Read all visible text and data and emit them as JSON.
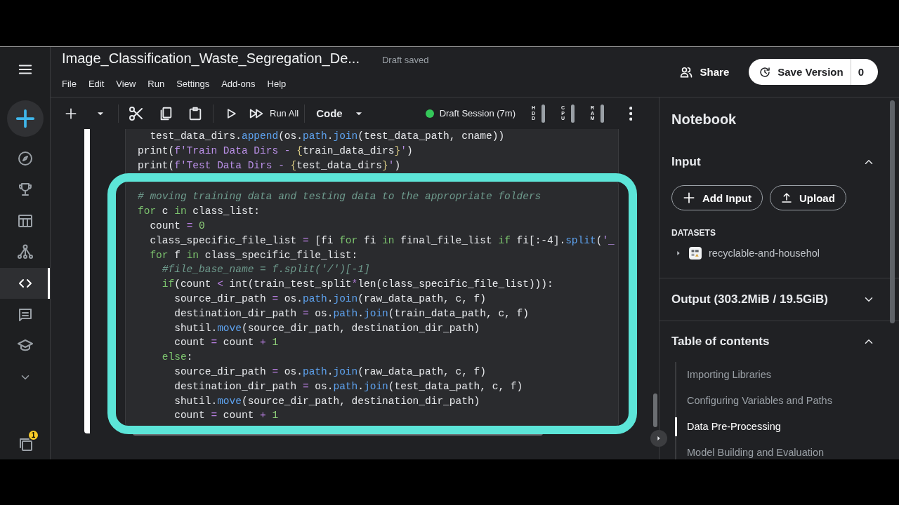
{
  "sidebar": {
    "items": [
      {
        "kind": "menu",
        "selected": false
      },
      {
        "kind": "create",
        "selected": false
      },
      {
        "kind": "explore",
        "selected": false
      },
      {
        "kind": "trophy",
        "selected": false
      },
      {
        "kind": "table",
        "selected": false
      },
      {
        "kind": "network",
        "selected": false
      },
      {
        "kind": "code",
        "selected": true
      },
      {
        "kind": "comments",
        "selected": false
      },
      {
        "kind": "learn",
        "selected": false
      },
      {
        "kind": "more",
        "selected": false
      },
      {
        "kind": "notifications",
        "selected": false,
        "badge": "1"
      }
    ]
  },
  "header": {
    "title": "Image_Classification_Waste_Segregation_De...",
    "save_status": "Draft saved",
    "share": "Share",
    "save_version": {
      "label": "Save Version",
      "count": "0"
    }
  },
  "menu": [
    "File",
    "Edit",
    "View",
    "Run",
    "Settings",
    "Add-ons",
    "Help"
  ],
  "toolbar": {
    "items": [
      {
        "kind": "add"
      },
      {
        "kind": "dropdown"
      },
      {
        "kind": "divider"
      },
      {
        "kind": "cut"
      },
      {
        "kind": "copy"
      },
      {
        "kind": "paste"
      },
      {
        "kind": "divider"
      },
      {
        "kind": "run"
      },
      {
        "kind": "run_all",
        "label": "Run All"
      },
      {
        "kind": "divider"
      },
      {
        "kind": "cell_type",
        "label": "Code"
      }
    ],
    "session": {
      "label": "Draft Session (7m)",
      "running": true
    },
    "meters": [
      {
        "label": "HDD"
      },
      {
        "label": "CPU"
      },
      {
        "label": "RAM"
      }
    ]
  },
  "cells": [
    {
      "selected": true,
      "highlighted": false,
      "lines": [
        [
          {
            "kind": "pl",
            "text": "  test_data_dirs."
          },
          {
            "kind": "fn",
            "text": "append"
          },
          {
            "kind": "pl",
            "text": "(os."
          },
          {
            "kind": "fn",
            "text": "path"
          },
          {
            "kind": "pl",
            "text": "."
          },
          {
            "kind": "fn",
            "text": "join"
          },
          {
            "kind": "pl",
            "text": "(test_data_path, cname))"
          }
        ],
        [
          {
            "kind": "pl",
            "text": "print("
          },
          {
            "kind": "str",
            "text": "f'Train Data Dirs - "
          },
          {
            "kind": "br",
            "text": "{"
          },
          {
            "kind": "pl",
            "text": "train_data_dirs"
          },
          {
            "kind": "br",
            "text": "}"
          },
          {
            "kind": "str",
            "text": "'"
          },
          {
            "kind": "pl",
            "text": ")"
          }
        ],
        [
          {
            "kind": "pl",
            "text": "print("
          },
          {
            "kind": "str",
            "text": "f'Test Data Dirs - "
          },
          {
            "kind": "br",
            "text": "{"
          },
          {
            "kind": "pl",
            "text": "test_data_dirs"
          },
          {
            "kind": "br",
            "text": "}"
          },
          {
            "kind": "str",
            "text": "'"
          },
          {
            "kind": "pl",
            "text": ")"
          }
        ]
      ]
    },
    {
      "selected": true,
      "highlighted": true,
      "lines": [
        [
          {
            "kind": "cmt",
            "text": "# moving training data and testing data to the appropriate folders"
          }
        ],
        [
          {
            "kind": "kw",
            "text": "for"
          },
          {
            "kind": "pl",
            "text": " c "
          },
          {
            "kind": "kw",
            "text": "in"
          },
          {
            "kind": "pl",
            "text": " class_list:"
          }
        ],
        [
          {
            "kind": "pl",
            "text": "  count "
          },
          {
            "kind": "op",
            "text": "="
          },
          {
            "kind": "num",
            "text": " 0"
          }
        ],
        [
          {
            "kind": "pl",
            "text": "  class_specific_file_list "
          },
          {
            "kind": "op",
            "text": "="
          },
          {
            "kind": "pl",
            "text": " [fi "
          },
          {
            "kind": "kw",
            "text": "for"
          },
          {
            "kind": "pl",
            "text": " fi "
          },
          {
            "kind": "kw",
            "text": "in"
          },
          {
            "kind": "pl",
            "text": " final_file_list "
          },
          {
            "kind": "kw",
            "text": "if"
          },
          {
            "kind": "pl",
            "text": " fi[:-4]."
          },
          {
            "kind": "fn",
            "text": "split"
          },
          {
            "kind": "pl",
            "text": "("
          },
          {
            "kind": "str",
            "text": "'_"
          }
        ],
        [
          {
            "kind": "kw",
            "text": "  for"
          },
          {
            "kind": "pl",
            "text": " f "
          },
          {
            "kind": "kw",
            "text": "in"
          },
          {
            "kind": "pl",
            "text": " class_specific_file_list:"
          }
        ],
        [
          {
            "kind": "cmt",
            "text": "    #file_base_name = f.split('/')[-1]"
          }
        ],
        [
          {
            "kind": "kw",
            "text": "    if"
          },
          {
            "kind": "pl",
            "text": "(count "
          },
          {
            "kind": "op",
            "text": "<"
          },
          {
            "kind": "pl",
            "text": " int(train_test_split"
          },
          {
            "kind": "op",
            "text": "*"
          },
          {
            "kind": "pl",
            "text": "len(class_specific_file_list))):"
          }
        ],
        [
          {
            "kind": "pl",
            "text": "      source_dir_path "
          },
          {
            "kind": "op",
            "text": "="
          },
          {
            "kind": "pl",
            "text": " os."
          },
          {
            "kind": "fn",
            "text": "path"
          },
          {
            "kind": "pl",
            "text": "."
          },
          {
            "kind": "fn",
            "text": "join"
          },
          {
            "kind": "pl",
            "text": "(raw_data_path, c, f)"
          }
        ],
        [
          {
            "kind": "pl",
            "text": "      destination_dir_path "
          },
          {
            "kind": "op",
            "text": "="
          },
          {
            "kind": "pl",
            "text": " os."
          },
          {
            "kind": "fn",
            "text": "path"
          },
          {
            "kind": "pl",
            "text": "."
          },
          {
            "kind": "fn",
            "text": "join"
          },
          {
            "kind": "pl",
            "text": "(train_data_path, c, f)"
          }
        ],
        [
          {
            "kind": "pl",
            "text": "      shutil."
          },
          {
            "kind": "fn",
            "text": "move"
          },
          {
            "kind": "pl",
            "text": "(source_dir_path, destination_dir_path)"
          }
        ],
        [
          {
            "kind": "pl",
            "text": "      count "
          },
          {
            "kind": "op",
            "text": "="
          },
          {
            "kind": "pl",
            "text": " count "
          },
          {
            "kind": "op",
            "text": "+"
          },
          {
            "kind": "num",
            "text": " 1"
          }
        ],
        [
          {
            "kind": "kw",
            "text": "    else"
          },
          {
            "kind": "pl",
            "text": ":"
          }
        ],
        [
          {
            "kind": "pl",
            "text": "      source_dir_path "
          },
          {
            "kind": "op",
            "text": "="
          },
          {
            "kind": "pl",
            "text": " os."
          },
          {
            "kind": "fn",
            "text": "path"
          },
          {
            "kind": "pl",
            "text": "."
          },
          {
            "kind": "fn",
            "text": "join"
          },
          {
            "kind": "pl",
            "text": "(raw_data_path, c, f)"
          }
        ],
        [
          {
            "kind": "pl",
            "text": "      destination_dir_path "
          },
          {
            "kind": "op",
            "text": "="
          },
          {
            "kind": "pl",
            "text": " os."
          },
          {
            "kind": "fn",
            "text": "path"
          },
          {
            "kind": "pl",
            "text": "."
          },
          {
            "kind": "fn",
            "text": "join"
          },
          {
            "kind": "pl",
            "text": "(test_data_path, c, f)"
          }
        ],
        [
          {
            "kind": "pl",
            "text": "      shutil."
          },
          {
            "kind": "fn",
            "text": "move"
          },
          {
            "kind": "pl",
            "text": "(source_dir_path, destination_dir_path)"
          }
        ],
        [
          {
            "kind": "pl",
            "text": "      count "
          },
          {
            "kind": "op",
            "text": "="
          },
          {
            "kind": "pl",
            "text": " count "
          },
          {
            "kind": "op",
            "text": "+"
          },
          {
            "kind": "num",
            "text": " 1"
          }
        ]
      ]
    }
  ],
  "panel": {
    "title": "Notebook",
    "sections": [
      {
        "kind": "input",
        "title": "Input",
        "expanded": true,
        "buttons": [
          {
            "kind": "add",
            "label": "Add Input"
          },
          {
            "kind": "upload",
            "label": "Upload"
          }
        ],
        "datasets_label": "DATASETS",
        "datasets": [
          {
            "name": "recyclable-and-househol",
            "expanded": false
          }
        ]
      },
      {
        "kind": "output",
        "title": "Output (303.2MiB / 19.5GiB)",
        "expanded": false
      },
      {
        "kind": "toc",
        "title": "Table of contents",
        "expanded": true,
        "items": [
          {
            "label": "Importing Libraries",
            "selected": false
          },
          {
            "label": "Configuring Variables and Paths",
            "selected": false
          },
          {
            "label": "Data Pre-Processing",
            "selected": true
          },
          {
            "label": "Model Building and Evaluation",
            "selected": false
          }
        ]
      }
    ]
  }
}
